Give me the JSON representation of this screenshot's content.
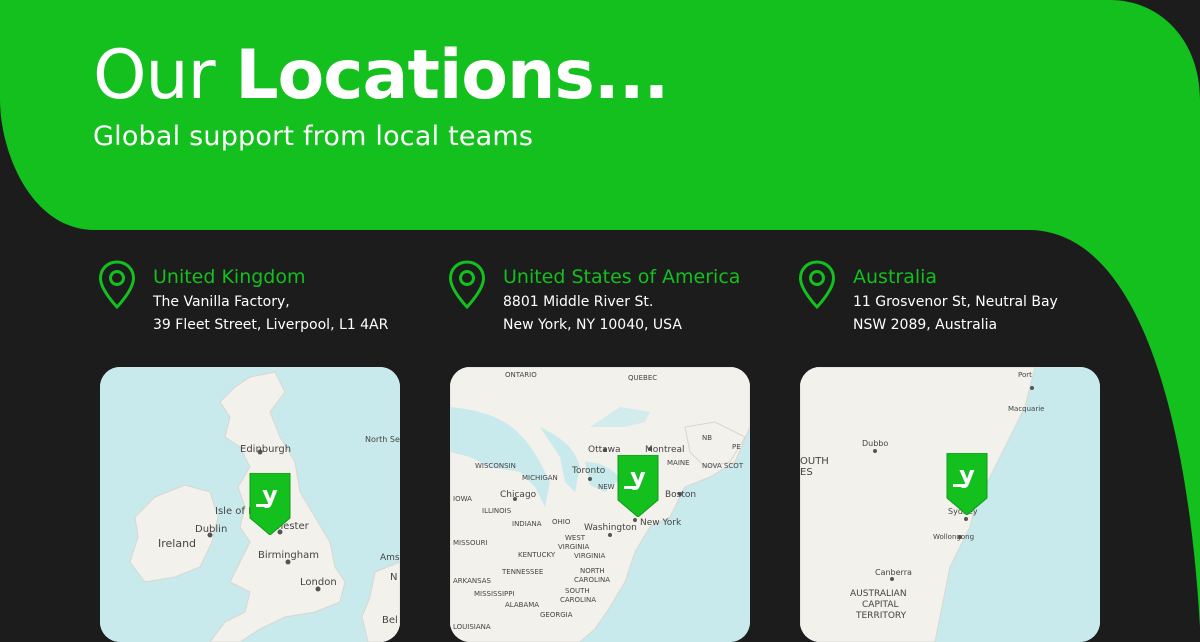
{
  "header": {
    "title_light": "Our ",
    "title_bold": "Locations...",
    "subtitle": "Global support from local teams"
  },
  "colors": {
    "brand_green": "#13c01e",
    "background": "#1c1c1c",
    "text": "#ffffff"
  },
  "locations": [
    {
      "country": "United Kingdom",
      "address_line1": "The Vanilla Factory,",
      "address_line2": "39 Fleet Street, Liverpool, L1 4AR",
      "map_labels": {
        "edinburgh": "Edinburgh",
        "north_sea": "North Se",
        "isle_of_man": "Isle of M",
        "dublin": "Dublin",
        "ireland": "Ireland",
        "manchester": "nchester",
        "birmingham": "Birmingham",
        "london": "London",
        "ams": "Ams",
        "bel": "Bel",
        "n": "N"
      }
    },
    {
      "country": "United States of America",
      "address_line1": "8801 Middle River St.",
      "address_line2": "New York, NY 10040, USA",
      "map_labels": {
        "ontario": "ONTARIO",
        "quebec": "QUEBEC",
        "nb": "NB",
        "pe": "PE",
        "ottawa": "Ottawa",
        "montreal": "Montreal",
        "maine": "MAINE",
        "nova_scotia": "NOVA SCOT",
        "wisconsin": "WISCONSIN",
        "toronto": "Toronto",
        "michigan": "MICHIGAN",
        "new": "NEW",
        "boston": "Boston",
        "iowa": "IOWA",
        "chicago": "Chicago",
        "illinois": "ILLINOIS",
        "indiana": "INDIANA",
        "ohio": "OHIO",
        "washington": "Washington",
        "new_york": "New York",
        "missouri": "MISSOURI",
        "west_virginia_1": "WEST",
        "west_virginia_2": "VIRGINIA",
        "kentucky": "KENTUCKY",
        "virginia": "VIRGINIA",
        "tennessee": "TENNESSEE",
        "north_carolina_1": "NORTH",
        "north_carolina_2": "CAROLINA",
        "arkansas": "ARKANSAS",
        "mississippi": "MISSISSIPPI",
        "south_carolina_1": "SOUTH",
        "south_carolina_2": "CAROLINA",
        "alabama": "ALABAMA",
        "georgia": "GEORGIA",
        "louisiana": "LOUISIANA"
      }
    },
    {
      "country": "Australia",
      "address_line1": "11 Grosvenor St, Neutral Bay",
      "address_line2": "NSW 2089, Australia",
      "map_labels": {
        "port_1": "Port",
        "port_2": "Macquarie",
        "dubbo": "Dubbo",
        "south_1": "OUTH",
        "south_2": "ES",
        "sydney": "Sydney",
        "wollongong": "Wollongong",
        "canberra": "Canberra",
        "act_1": "AUSTRALIAN",
        "act_2": "CAPITAL",
        "act_3": "TERRITORY"
      }
    }
  ],
  "marker_glyph": "y"
}
